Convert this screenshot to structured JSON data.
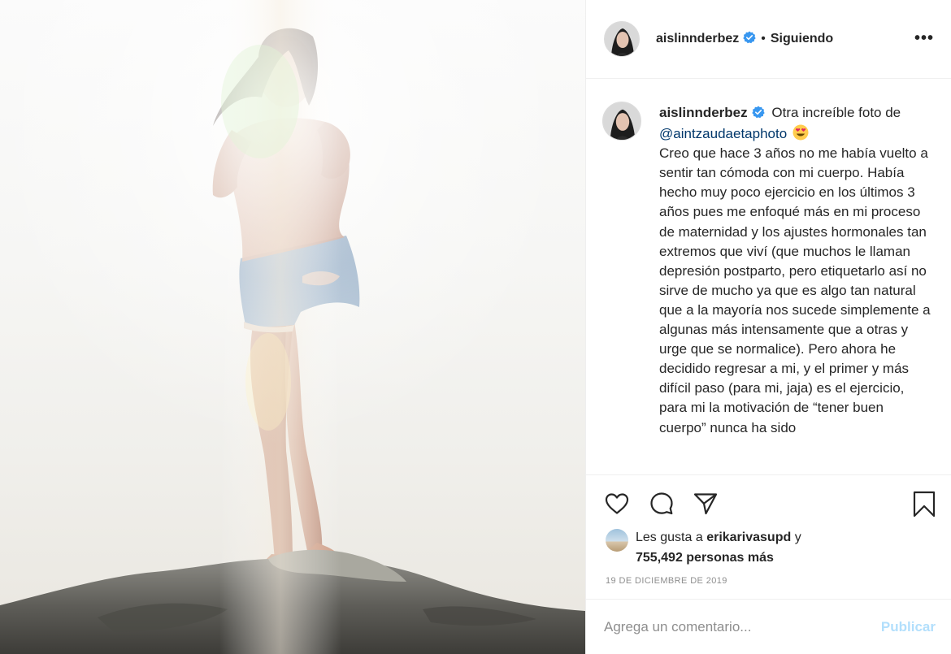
{
  "post": {
    "username": "aislinnderbez",
    "follow_separator": "•",
    "follow_status": "Siguiendo",
    "more_label": "•••",
    "photo_alt": "Foto de aislinnderbez"
  },
  "caption": {
    "username": "aislinnderbez",
    "intro": "Otra increíble foto de",
    "mention": "@aintzaudaetaphoto",
    "body": "Creo que hace 3 años no me había vuelto a sentir tan cómoda con mi cuerpo. Había hecho muy poco ejercicio en los últimos 3 años pues me enfoqué más en mi proceso de maternidad y los ajustes hormonales tan extremos que viví (que muchos le llaman depresión postparto, pero etiquetarlo así no sirve de mucho ya que es algo tan natural que a la mayoría nos sucede simplemente a algunas más intensamente que a otras y urge que se normalice). Pero ahora he decidido regresar a mi, y el primer y más difícil paso (para mi, jaja) es el ejercicio, para mi la motivación de “tener buen cuerpo” nunca ha sido"
  },
  "likes": {
    "prefix": "Les gusta a",
    "liker": "erikarivasupd",
    "conjunction": "y",
    "count_text": "755,492 personas más"
  },
  "date": "19 DE DICIEMBRE DE 2019",
  "comment": {
    "placeholder": "Agrega un comentario...",
    "publish_label": "Publicar"
  },
  "icons": {
    "like": "heart-icon",
    "comment": "comment-bubble-icon",
    "share": "paper-plane-icon",
    "save": "bookmark-icon",
    "verified": "verified-badge-icon",
    "emoji": "heart-eyes-emoji"
  },
  "colors": {
    "verified_blue": "#3897f0",
    "link": "#00376b",
    "publish_disabled": "#b2dffc",
    "meta_gray": "#8e8e8e",
    "border": "#efefef"
  }
}
